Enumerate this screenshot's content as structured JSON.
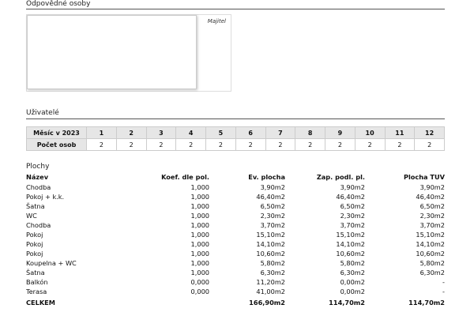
{
  "persons": {
    "title": "Odpovědné osoby",
    "role_label": "Majitel"
  },
  "users": {
    "title": "Uživatelé",
    "month_label": "Měsíc v 2023",
    "count_label": "Počet osob",
    "months": [
      "1",
      "2",
      "3",
      "4",
      "5",
      "6",
      "7",
      "8",
      "9",
      "10",
      "11",
      "12"
    ],
    "counts": [
      "2",
      "2",
      "2",
      "2",
      "2",
      "2",
      "2",
      "2",
      "2",
      "2",
      "2",
      "2"
    ]
  },
  "areas": {
    "title": "Plochy",
    "headers": {
      "name": "Název",
      "coef": "Koef. dle pol.",
      "ev": "Ev. plocha",
      "zap": "Zap. podl. pl.",
      "tuv": "Plocha TUV"
    },
    "rows": [
      {
        "name": "Chodba",
        "coef": "1,000",
        "ev": "3,90m2",
        "zap": "3,90m2",
        "tuv": "3,90m2"
      },
      {
        "name": "Pokoj + k.k.",
        "coef": "1,000",
        "ev": "46,40m2",
        "zap": "46,40m2",
        "tuv": "46,40m2"
      },
      {
        "name": "Šatna",
        "coef": "1,000",
        "ev": "6,50m2",
        "zap": "6,50m2",
        "tuv": "6,50m2"
      },
      {
        "name": "WC",
        "coef": "1,000",
        "ev": "2,30m2",
        "zap": "2,30m2",
        "tuv": "2,30m2"
      },
      {
        "name": "Chodba",
        "coef": "1,000",
        "ev": "3,70m2",
        "zap": "3,70m2",
        "tuv": "3,70m2"
      },
      {
        "name": "Pokoj",
        "coef": "1,000",
        "ev": "15,10m2",
        "zap": "15,10m2",
        "tuv": "15,10m2"
      },
      {
        "name": "Pokoj",
        "coef": "1,000",
        "ev": "14,10m2",
        "zap": "14,10m2",
        "tuv": "14,10m2"
      },
      {
        "name": "Pokoj",
        "coef": "1,000",
        "ev": "10,60m2",
        "zap": "10,60m2",
        "tuv": "10,60m2"
      },
      {
        "name": "Koupelna + WC",
        "coef": "1,000",
        "ev": "5,80m2",
        "zap": "5,80m2",
        "tuv": "5,80m2"
      },
      {
        "name": "Šatna",
        "coef": "1,000",
        "ev": "6,30m2",
        "zap": "6,30m2",
        "tuv": "6,30m2"
      },
      {
        "name": "Balkón",
        "coef": "0,000",
        "ev": "11,20m2",
        "zap": "0,00m2",
        "tuv": "-"
      },
      {
        "name": "Terasa",
        "coef": "0,000",
        "ev": "41,00m2",
        "zap": "0,00m2",
        "tuv": "-"
      }
    ],
    "total": {
      "name": "CELKEM",
      "coef": "",
      "ev": "166,90m2",
      "zap": "114,70m2",
      "tuv": "114,70m2"
    }
  }
}
